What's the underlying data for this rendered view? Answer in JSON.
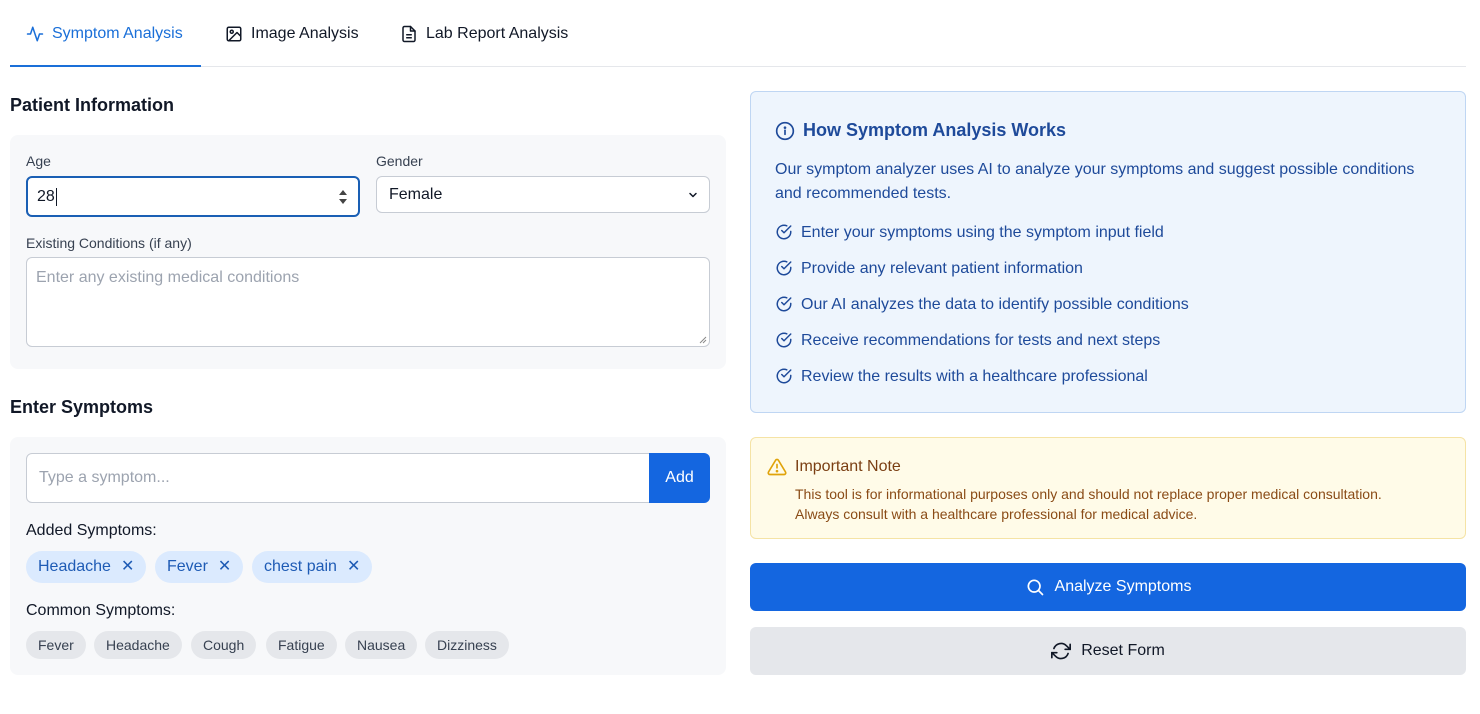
{
  "tabs": [
    {
      "label": "Symptom Analysis",
      "icon": "activity-icon",
      "active": true
    },
    {
      "label": "Image Analysis",
      "icon": "image-icon",
      "active": false
    },
    {
      "label": "Lab Report Analysis",
      "icon": "file-icon",
      "active": false
    }
  ],
  "patient": {
    "title": "Patient Information",
    "age_label": "Age",
    "age_value": "28",
    "gender_label": "Gender",
    "gender_value": "Female",
    "conditions_label": "Existing Conditions (if any)",
    "conditions_placeholder": "Enter any existing medical conditions"
  },
  "symptoms": {
    "title": "Enter Symptoms",
    "input_placeholder": "Type a symptom...",
    "add_label": "Add",
    "added_title": "Added Symptoms:",
    "added": [
      "Headache",
      "Fever",
      "chest pain"
    ],
    "remove_glyph": "✕",
    "common_title": "Common Symptoms:",
    "common": [
      "Fever",
      "Headache",
      "Cough",
      "Fatigue",
      "Nausea",
      "Dizziness"
    ]
  },
  "info": {
    "title": "How Symptom Analysis Works",
    "description": "Our symptom analyzer uses AI to analyze your symptoms and suggest possible conditions and recommended tests.",
    "steps": [
      "Enter your symptoms using the symptom input field",
      "Provide any relevant patient information",
      "Our AI analyzes the data to identify possible conditions",
      "Receive recommendations for tests and next steps",
      "Review the results with a healthcare professional"
    ]
  },
  "note": {
    "title": "Important Note",
    "line1": "This tool is for informational purposes only and should not replace proper medical consultation.",
    "line2": "Always consult with a healthcare professional for medical advice."
  },
  "actions": {
    "analyze_label": "Analyze Symptoms",
    "reset_label": "Reset Form"
  },
  "colors": {
    "primary": "#1466e0",
    "info_bg": "#eef5fd",
    "info_text": "#1e4a9a",
    "note_bg": "#fffbe8",
    "note_text": "#8a4b16",
    "chip_bg": "#dbeafe"
  }
}
